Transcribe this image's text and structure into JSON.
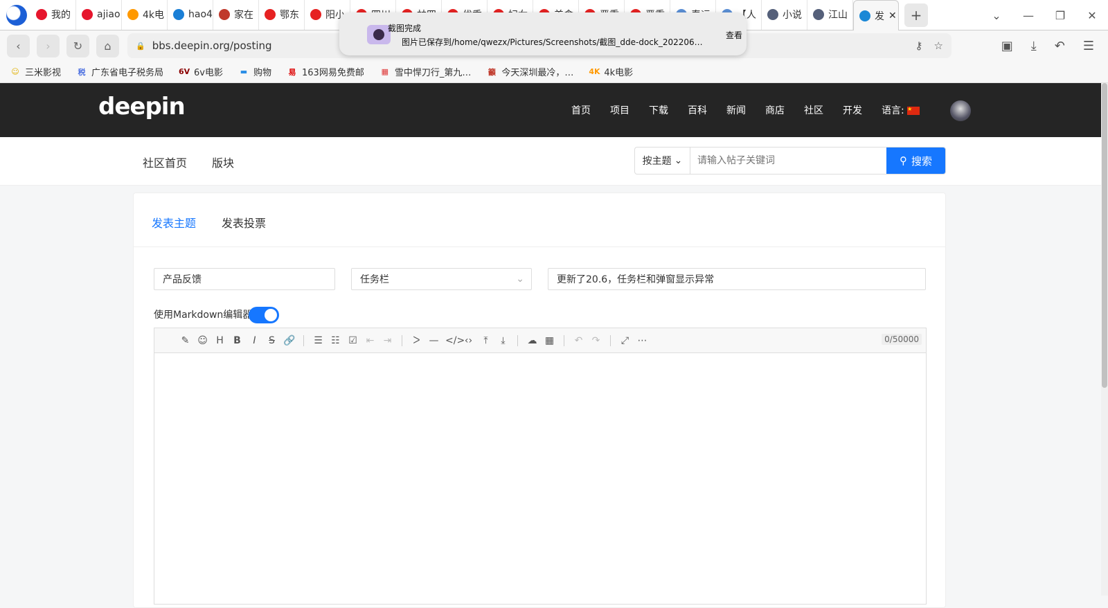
{
  "browser": {
    "tabs": [
      {
        "label": "我的",
        "color": "#e6162d"
      },
      {
        "label": "ajiao",
        "color": "#e6162d"
      },
      {
        "label": "4k电",
        "color": "#ff9900"
      },
      {
        "label": "hao4",
        "color": "#1a7fd6"
      },
      {
        "label": "家在",
        "color": "#c0392b"
      },
      {
        "label": "鄂东",
        "color": "#e62222"
      },
      {
        "label": "阳小",
        "color": "#e62222"
      },
      {
        "label": "四川",
        "color": "#e62222"
      },
      {
        "label": "林四",
        "color": "#e62222"
      },
      {
        "label": "优秀",
        "color": "#e62222"
      },
      {
        "label": "妇女",
        "color": "#e62222"
      },
      {
        "label": "美食",
        "color": "#e62222"
      },
      {
        "label": "严重",
        "color": "#e62222"
      },
      {
        "label": "严重",
        "color": "#e62222"
      },
      {
        "label": "春运",
        "color": "#5b8fd6"
      },
      {
        "label": "【人",
        "color": "#5b8fd6"
      },
      {
        "label": "小说",
        "color": "#55607a"
      },
      {
        "label": "江山",
        "color": "#55607a"
      },
      {
        "label": "发",
        "color": "#1a88d6"
      }
    ],
    "url": "bbs.deepin.org/posting",
    "bookmarks": [
      {
        "icon": "☺",
        "label": "三米影视",
        "color": "#e0b000"
      },
      {
        "icon": "税",
        "label": "广东省电子税务局",
        "color": "#4a6ee0"
      },
      {
        "icon": "6V",
        "label": "6v电影",
        "color": "#8b0000"
      },
      {
        "icon": "▬",
        "label": "购物",
        "color": "#2a8ee6"
      },
      {
        "icon": "易",
        "label": "163网易免费邮",
        "color": "#d00"
      },
      {
        "icon": "▦",
        "label": "雪中悍刀行_第九…",
        "color": "#d33"
      },
      {
        "icon": "籲",
        "label": "今天深圳最冷，…",
        "color": "#c0392b"
      },
      {
        "icon": "4K",
        "label": "4k电影",
        "color": "#ff9900"
      }
    ]
  },
  "notification": {
    "title": "截图完成",
    "body": "图片已保存到/home/qwezx/Pictures/Screenshots/截图_dde-dock_20220611…",
    "action": "查看"
  },
  "site": {
    "brand": "deepin",
    "nav": [
      "首页",
      "项目",
      "下载",
      "百科",
      "新闻",
      "商店",
      "社区",
      "开发"
    ],
    "language_label": "语言:",
    "sub_nav": [
      "社区首页",
      "版块"
    ],
    "search": {
      "mode": "按主题",
      "placeholder": "请输入帖子关键词",
      "button": "搜索"
    }
  },
  "post": {
    "tabs": [
      "发表主题",
      "发表投票"
    ],
    "forum": "产品反馈",
    "category": "任务栏",
    "title": "更新了20.6，任务栏和弹窗显示异常",
    "markdown_label": "使用Markdown编辑器",
    "markdown_enabled": true,
    "char_count": "0/50000"
  },
  "colors": {
    "accent": "#1677ff",
    "header": "#252525"
  }
}
